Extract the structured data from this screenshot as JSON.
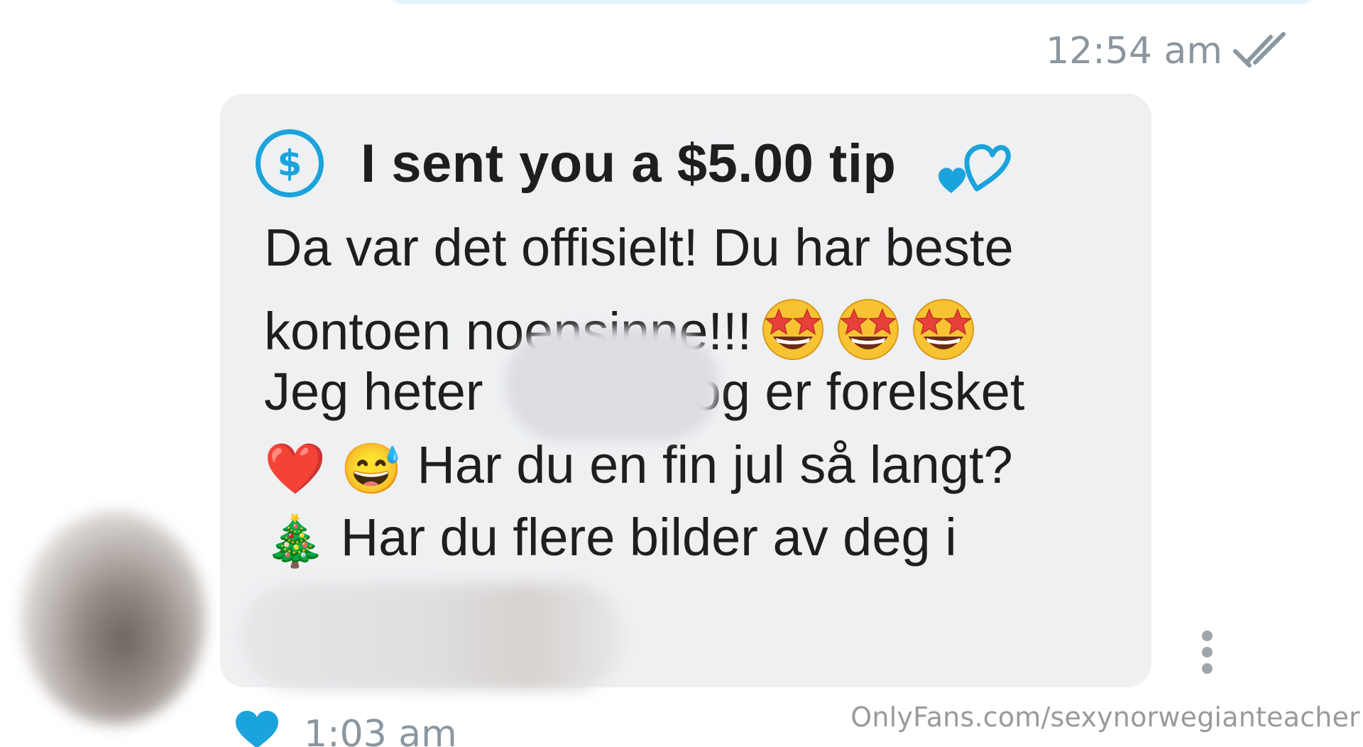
{
  "sent_message": {
    "time": "12:54 am",
    "status_icon": "double-check-icon"
  },
  "received_message": {
    "tip": {
      "icon": "dollar-icon",
      "text": "I sent you a $5.00 tip",
      "accessory_icon": "hearts-icon"
    },
    "lines": {
      "line1": "Da var det offisielt! Du har beste",
      "line2_text": "kontoen noensinne!!!",
      "line2_emoji": [
        "star-struck-icon",
        "star-struck-icon",
        "star-struck-icon"
      ],
      "line3_before": "Jeg heter",
      "line3_after": "og er forelsket",
      "line4_emoji_heart": "❤️",
      "line4_emoji_face": "😅",
      "line4_text": "Har du en fin jul så langt?",
      "line5_emoji": "🎄",
      "line5_text": "Har du flere bilder av deg i"
    },
    "time": "1:03 am",
    "liked_icon": "heart-icon",
    "menu_icon": "more-vertical-icon"
  },
  "watermark": "OnlyFans.com/sexynorwegianteacher",
  "colors": {
    "accent": "#1ba3dc",
    "bubble_received": "#eef0f2",
    "bubble_sent": "#e4f3fb",
    "meta_text": "#8a96a0"
  }
}
